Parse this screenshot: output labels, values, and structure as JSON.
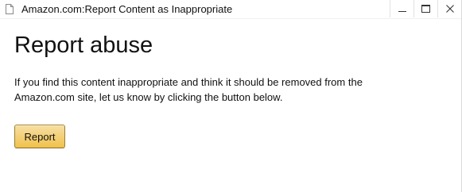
{
  "window": {
    "title": "Amazon.com:Report Content as Inappropriate",
    "controls": {
      "minimize_icon": "minimize-icon",
      "maximize_icon": "maximize-icon",
      "close_icon": "close-icon"
    }
  },
  "main": {
    "heading": "Report abuse",
    "description": "If you find this content inappropriate and think it should be removed from the Amazon.com site, let us know by clicking the button below.",
    "report_button_label": "Report"
  },
  "colors": {
    "button_gradient_top": "#f7dfa5",
    "button_gradient_bottom": "#f0c14b",
    "button_border": "#a88734"
  }
}
